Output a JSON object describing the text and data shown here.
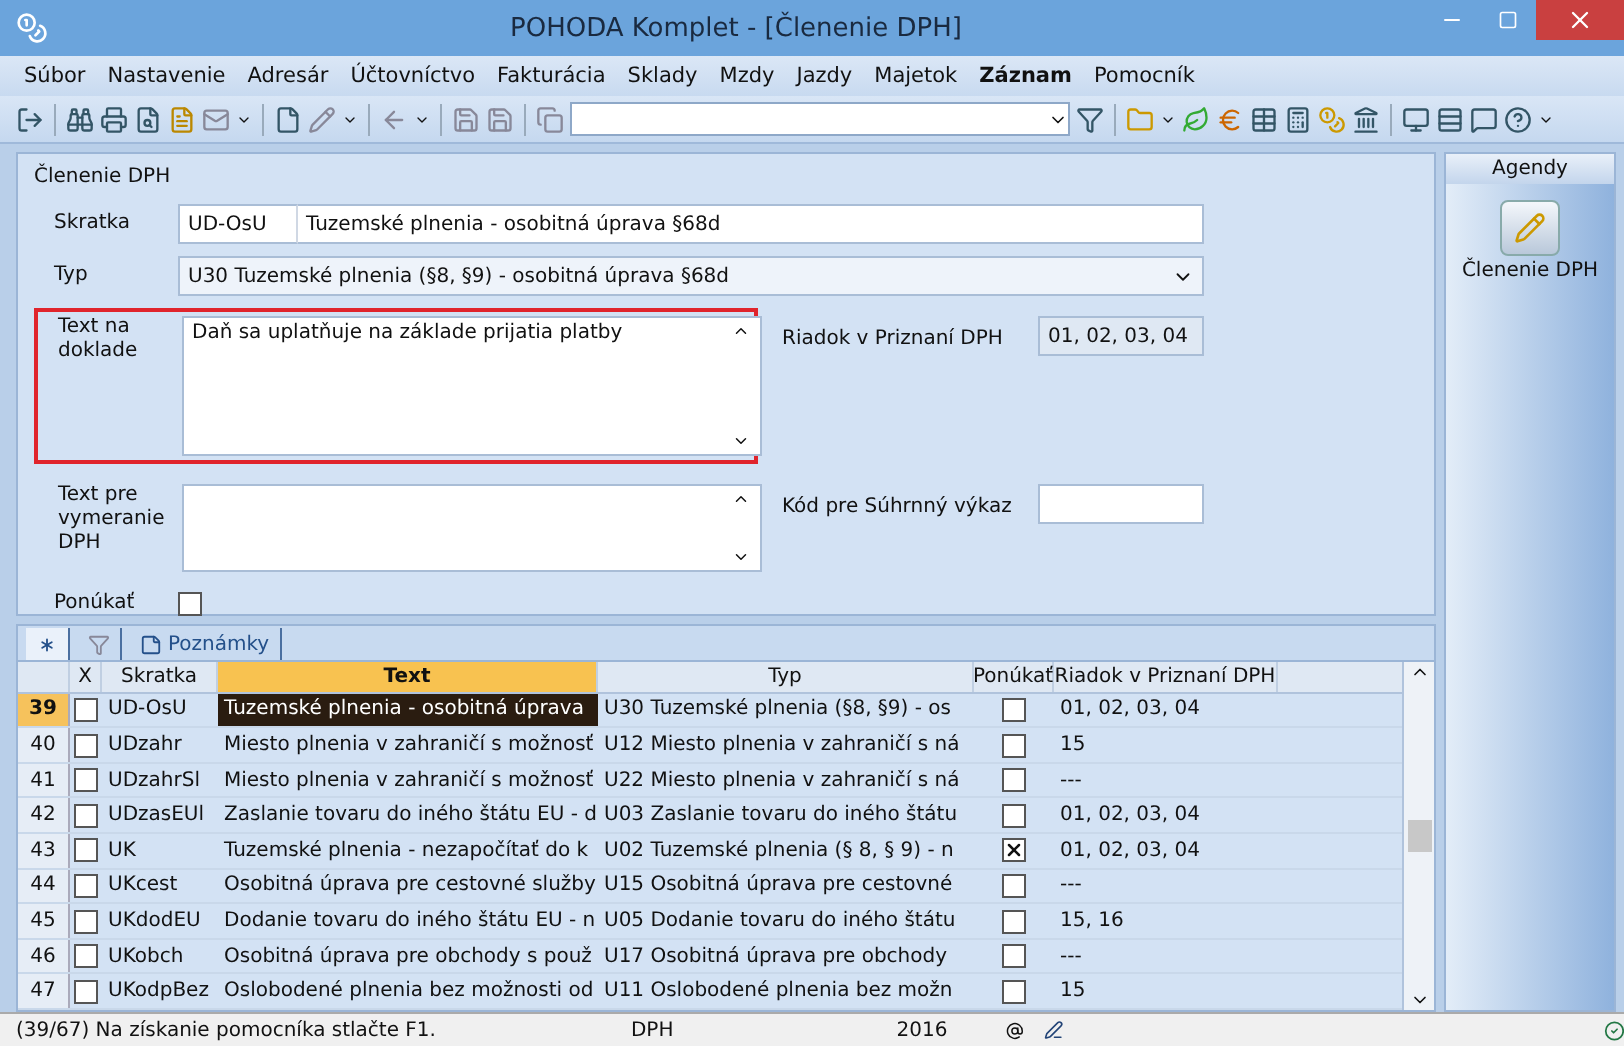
{
  "window": {
    "title": "POHODA Komplet - [Členenie DPH]"
  },
  "menu": [
    {
      "label": "Súbor",
      "bold": false
    },
    {
      "label": "Nastavenie",
      "bold": false
    },
    {
      "label": "Adresár",
      "bold": false
    },
    {
      "label": "Účtovníctvo",
      "bold": false
    },
    {
      "label": "Fakturácia",
      "bold": false
    },
    {
      "label": "Sklady",
      "bold": false
    },
    {
      "label": "Mzdy",
      "bold": false
    },
    {
      "label": "Jazdy",
      "bold": false
    },
    {
      "label": "Majetok",
      "bold": false
    },
    {
      "label": "Záznam",
      "bold": true
    },
    {
      "label": "Pomocník",
      "bold": false
    }
  ],
  "form": {
    "title": "Členenie DPH",
    "skratka": {
      "label": "Skratka",
      "code": "UD-OsU",
      "name": "Tuzemské plnenia - osobitná úprava §68d"
    },
    "typ": {
      "label": "Typ",
      "value": "U30 Tuzemské plnenia (§8, §9) - osobitná úprava §68d"
    },
    "text_na_doklade": {
      "label": "Text na doklade",
      "value": "Daň sa uplatňuje na základe prijatia platby",
      "highlighted": true
    },
    "text_pre_vymeranie": {
      "label": "Text pre vymeranie DPH",
      "highlighted": false
    },
    "ponukat": {
      "label": "Ponúkať",
      "checked": false
    },
    "riadok": {
      "label": "Riadok v Priznaní DPH",
      "value": "01, 02, 03, 04"
    },
    "kod": {
      "label": "Kód pre Súhrnný výkaz"
    }
  },
  "tabs": [
    {
      "kind": "star",
      "selected": true
    },
    {
      "kind": "filter",
      "selected": false
    },
    {
      "kind": "notes",
      "label": "Poznámky",
      "selected": false
    }
  ],
  "table": {
    "columns": [
      "X",
      "Skratka",
      "Text",
      "Typ",
      "Ponúkať",
      "Riadok v Priznaní DPH"
    ],
    "rows": [
      {
        "number": "39",
        "x": false,
        "skratka": "UD-OsU",
        "text": "Tuzemské plnenia - osobitná úprava",
        "typ": "U30 Tuzemské plnenia (§8, §9) - os",
        "ponukat": false,
        "riadok": "01, 02, 03, 04",
        "selected": true
      },
      {
        "number": "40",
        "x": false,
        "skratka": "UDzahr",
        "text": "Miesto plnenia v zahraničí s možnosť",
        "typ": "U12 Miesto plnenia v zahraničí s ná",
        "ponukat": false,
        "riadok": "15",
        "selected": false
      },
      {
        "number": "41",
        "x": false,
        "skratka": "UDzahrSl",
        "text": "Miesto plnenia v zahraničí s možnosť",
        "typ": "U22 Miesto plnenia v zahraničí s ná",
        "ponukat": false,
        "riadok": "---",
        "selected": false
      },
      {
        "number": "42",
        "x": false,
        "skratka": "UDzasEUl",
        "text": "Zaslanie tovaru do iného štátu EU - d",
        "typ": "U03 Zaslanie tovaru do iného štátu",
        "ponukat": false,
        "riadok": "01, 02, 03, 04",
        "selected": false
      },
      {
        "number": "43",
        "x": false,
        "skratka": "UK",
        "text": "Tuzemské plnenia - nezapočítať do k",
        "typ": "U02 Tuzemské plnenia (§ 8, § 9) - n",
        "ponukat": true,
        "riadok": "01, 02, 03, 04",
        "selected": false
      },
      {
        "number": "44",
        "x": false,
        "skratka": "UKcest",
        "text": "Osobitná úprava pre cestovné služby",
        "typ": "U15 Osobitná úprava pre cestovné",
        "ponukat": false,
        "riadok": "---",
        "selected": false
      },
      {
        "number": "45",
        "x": false,
        "skratka": "UKdodEU",
        "text": "Dodanie tovaru do iného štátu EU - n",
        "typ": "U05 Dodanie tovaru do iného štátu",
        "ponukat": false,
        "riadok": "15, 16",
        "selected": false
      },
      {
        "number": "46",
        "x": false,
        "skratka": "UKobch",
        "text": "Osobitná úprava pre obchody s použ",
        "typ": "U17 Osobitná úprava pre obchody",
        "ponukat": false,
        "riadok": "---",
        "selected": false
      },
      {
        "number": "47",
        "x": false,
        "skratka": "UKodpBez",
        "text": "Oslobodené plnenia bez možnosti od",
        "typ": "U11 Oslobodené plnenia bez možn",
        "ponukat": false,
        "riadok": "15",
        "selected": false
      }
    ]
  },
  "agendy": {
    "title": "Agendy",
    "item": "Členenie DPH"
  },
  "status_bar": {
    "message": "(39/67) Na získanie pomocníka stlačte F1.",
    "module": "DPH",
    "year": "2016"
  }
}
